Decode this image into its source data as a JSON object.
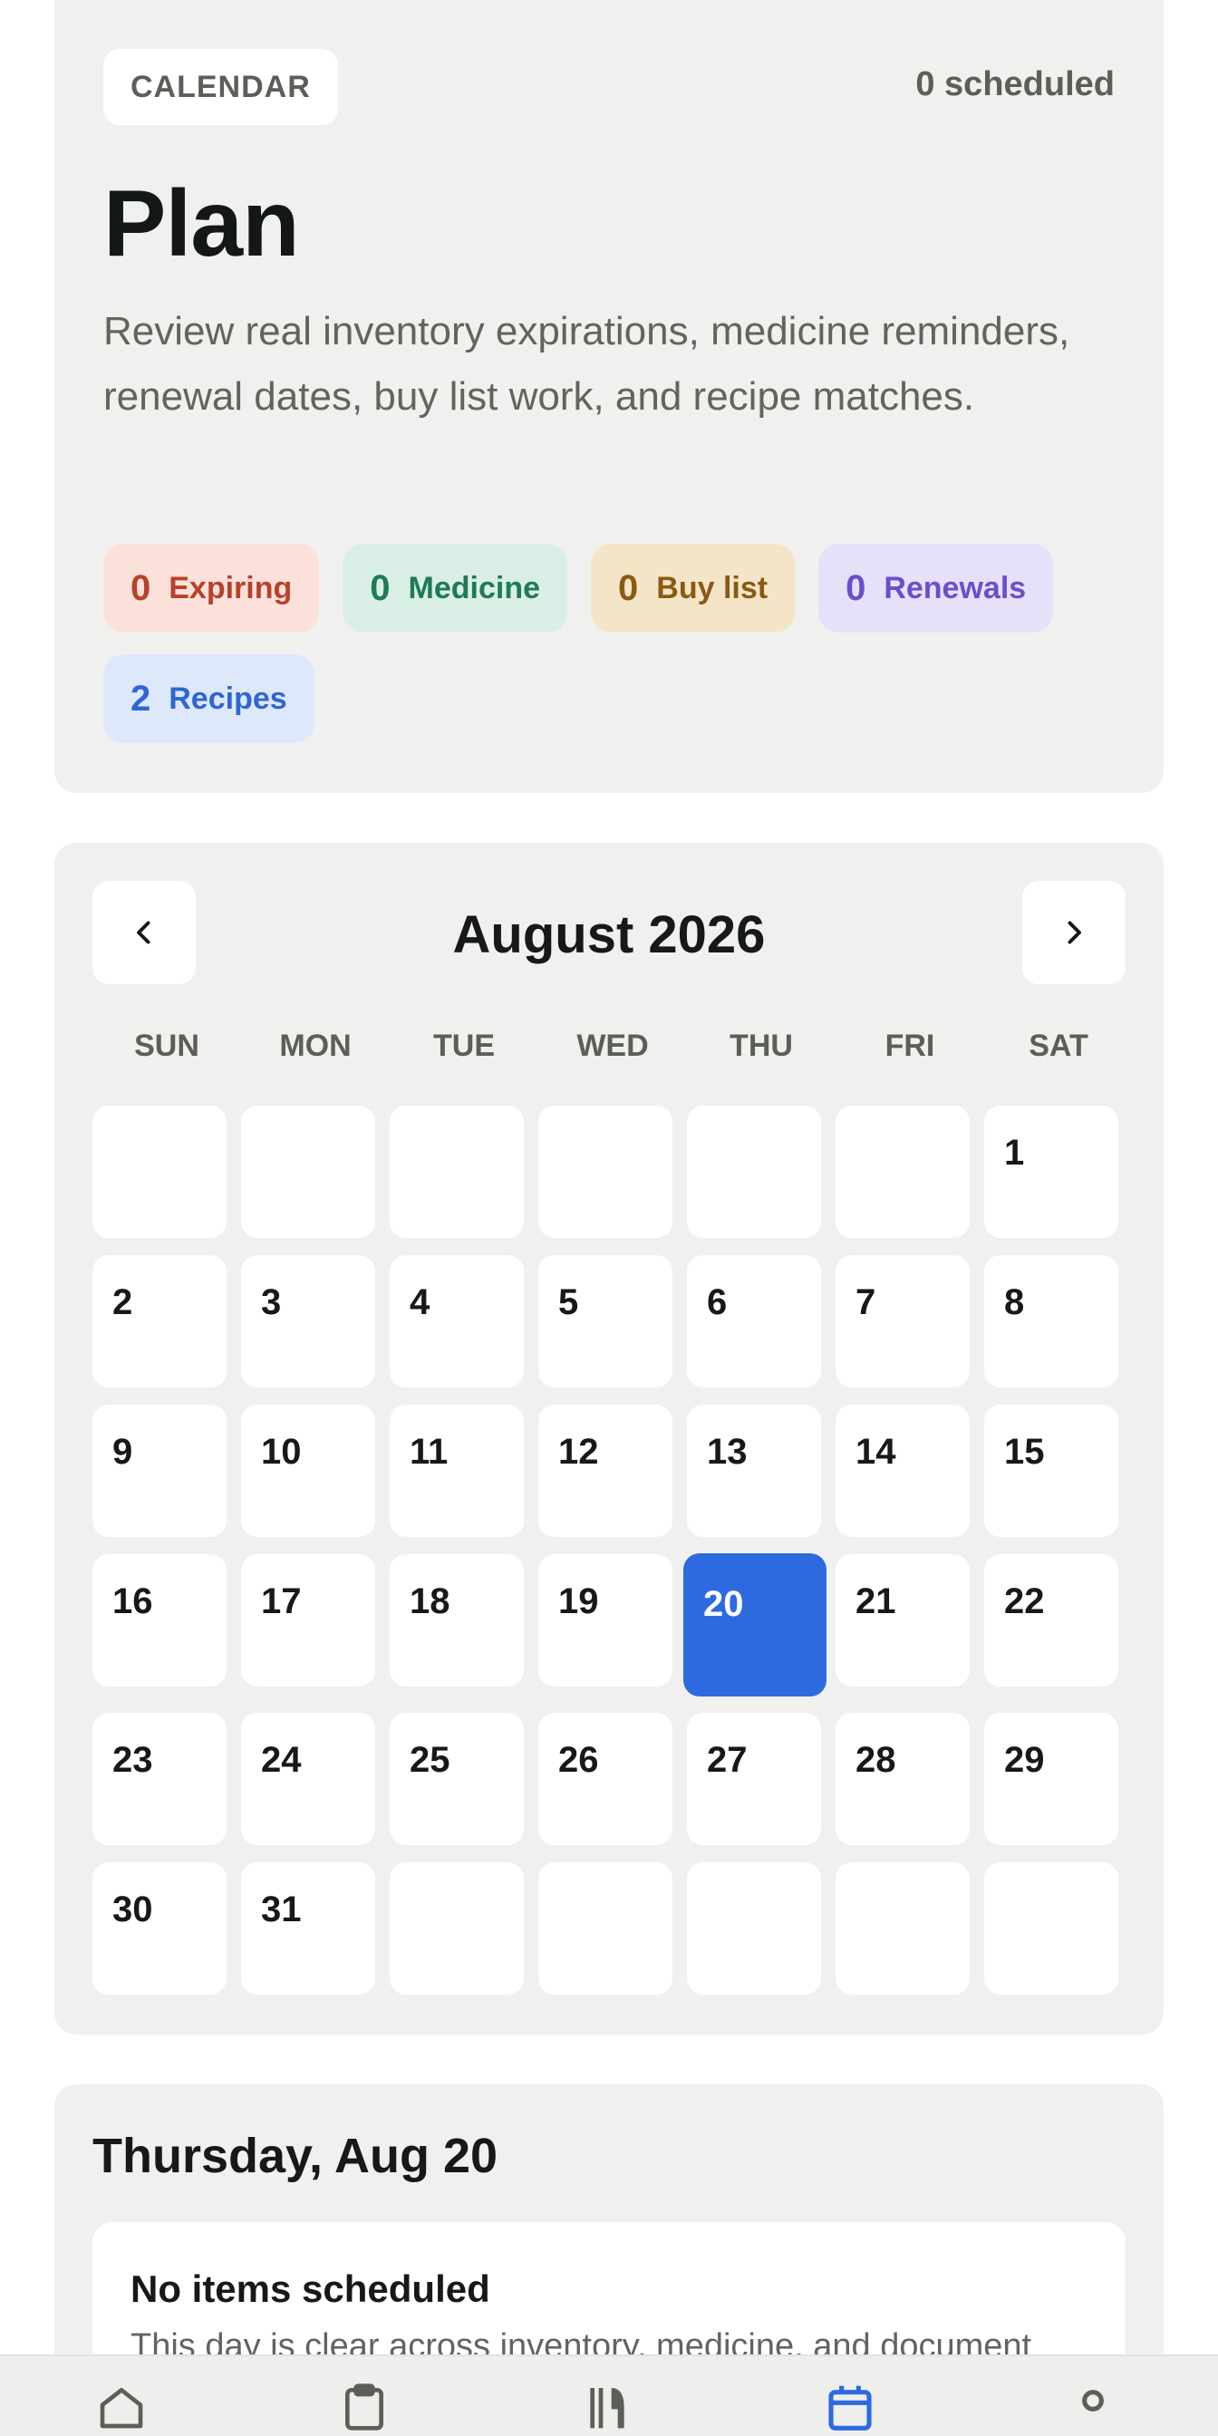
{
  "header": {
    "tag": "CALENDAR",
    "scheduled": "0 scheduled",
    "title": "Plan",
    "description": "Review real inventory expirations, medicine reminders, renewal dates, buy list work, and recipe matches."
  },
  "chips": [
    {
      "count": "0",
      "label": "Expiring",
      "color": "#b8412a"
    },
    {
      "count": "0",
      "label": "Medicine",
      "color": "#1f7a55"
    },
    {
      "count": "0",
      "label": "Buy list",
      "color": "#8a5a12"
    },
    {
      "count": "0",
      "label": "Renewals",
      "color": "#6a4fcc"
    },
    {
      "count": "2",
      "label": "Recipes",
      "color": "#2f66d3"
    }
  ],
  "calendar": {
    "month_label": "August 2026",
    "weekdays": [
      "SUN",
      "MON",
      "TUE",
      "WED",
      "THU",
      "FRI",
      "SAT"
    ],
    "days": [
      "",
      "",
      "",
      "",
      "",
      "",
      "1",
      "2",
      "3",
      "4",
      "5",
      "6",
      "7",
      "8",
      "9",
      "10",
      "11",
      "12",
      "13",
      "14",
      "15",
      "16",
      "17",
      "18",
      "19",
      "20",
      "21",
      "22",
      "23",
      "24",
      "25",
      "26",
      "27",
      "28",
      "29",
      "30",
      "31",
      "",
      "",
      "",
      "",
      ""
    ],
    "selected_day": "20",
    "accent": "#2d6ae0"
  },
  "detail": {
    "title": "Thursday, Aug 20",
    "empty_title": "No items scheduled",
    "empty_text": "This day is clear across inventory, medicine, and document"
  },
  "bottom_nav": {
    "items": [
      {
        "icon": "home-icon",
        "active": false
      },
      {
        "icon": "clipboard-icon",
        "active": false
      },
      {
        "icon": "utensils-icon",
        "active": false
      },
      {
        "icon": "calendar-icon",
        "active": true
      },
      {
        "icon": "profile-icon",
        "active": false
      }
    ],
    "active_color": "#2d6ae0"
  }
}
